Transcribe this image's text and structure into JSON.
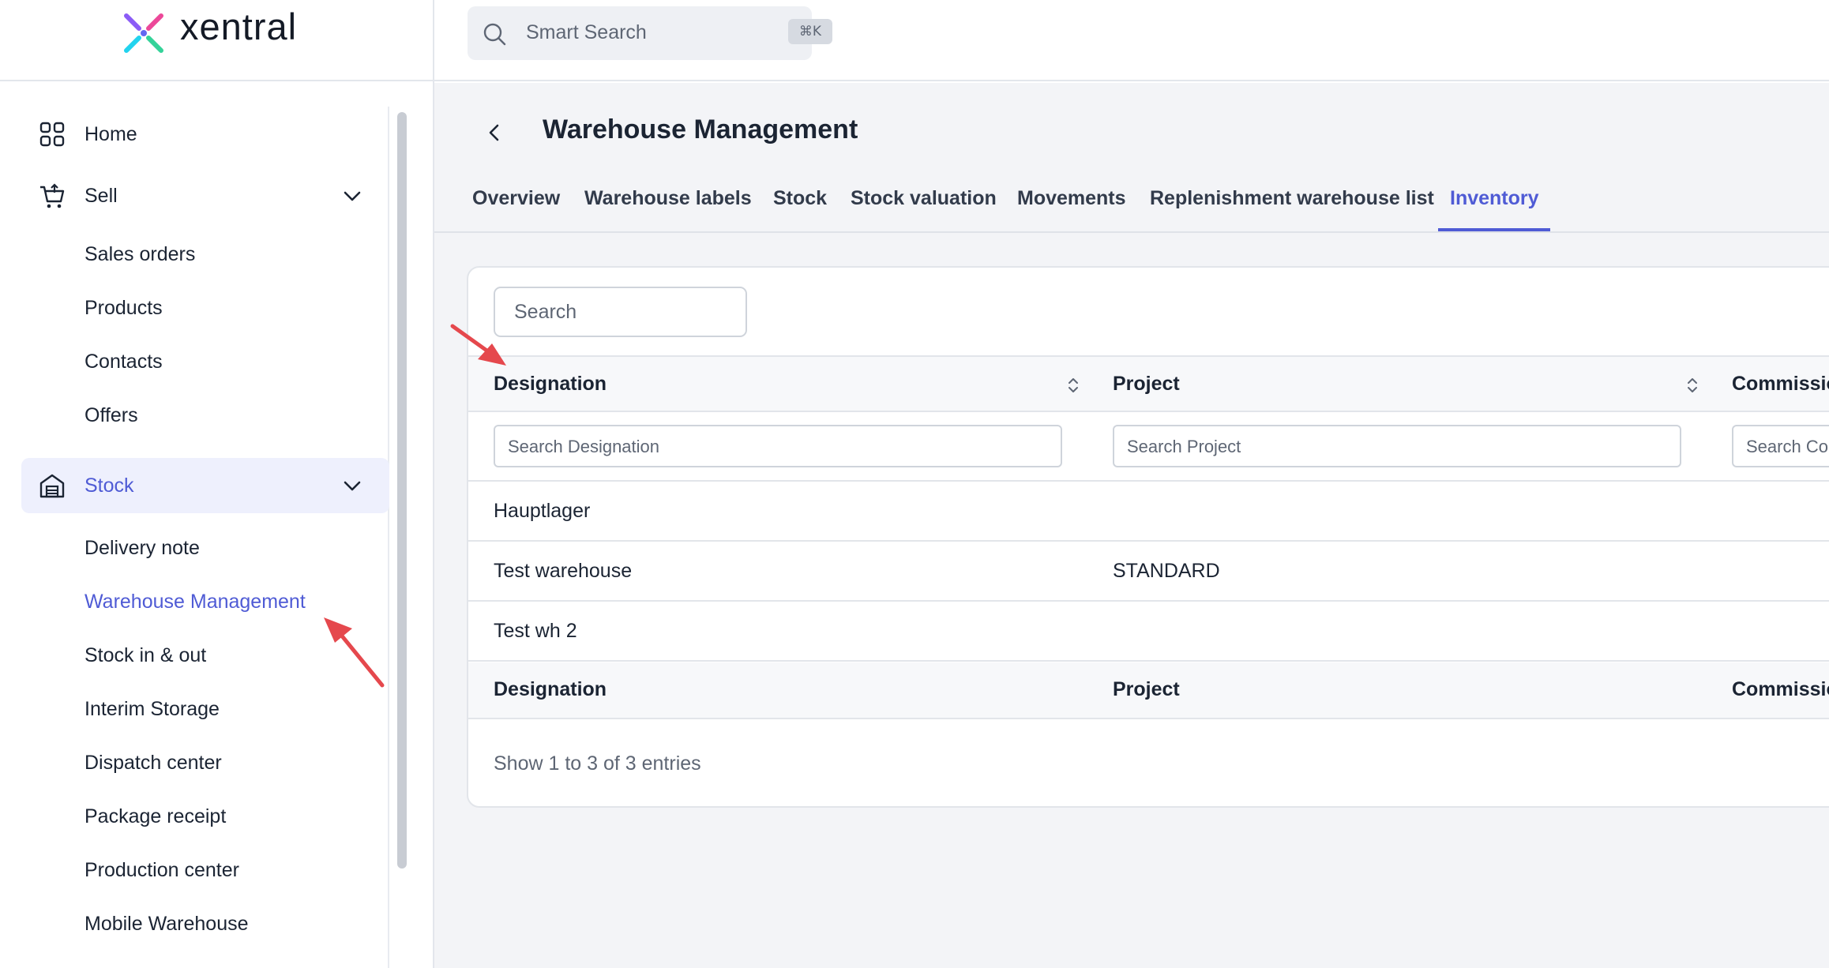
{
  "brand": {
    "name": "xentral"
  },
  "search": {
    "placeholder": "Smart Search",
    "shortcut": "⌘K"
  },
  "sidebar": {
    "items": [
      {
        "label": "Home",
        "icon": "grid-icon"
      },
      {
        "label": "Sell",
        "icon": "cart-icon",
        "expanded": true
      },
      {
        "label": "Stock",
        "icon": "warehouse-icon",
        "expanded": true,
        "active": true
      }
    ],
    "sell_children": [
      "Sales orders",
      "Products",
      "Contacts",
      "Offers"
    ],
    "stock_children": [
      "Delivery note",
      "Warehouse Management",
      "Stock in & out",
      "Interim Storage",
      "Dispatch center",
      "Package receipt",
      "Production center",
      "Mobile Warehouse"
    ],
    "active_child": "Warehouse Management"
  },
  "page": {
    "title": "Warehouse Management"
  },
  "tabs": [
    "Overview",
    "Warehouse labels",
    "Stock",
    "Stock valuation",
    "Movements",
    "Replenishment warehouse list",
    "Inventory"
  ],
  "active_tab": "Inventory",
  "table": {
    "search_placeholder": "Search",
    "columns": [
      "Designation",
      "Project",
      "Commissio"
    ],
    "filters": [
      "Search Designation",
      "Search Project",
      "Search Co"
    ],
    "rows": [
      {
        "designation": "Hauptlager",
        "project": ""
      },
      {
        "designation": "Test warehouse",
        "project": "STANDARD"
      },
      {
        "designation": "Test wh 2",
        "project": ""
      }
    ],
    "footer_columns": [
      "Designation",
      "Project",
      "Commissio"
    ],
    "entries_text": "Show 1 to 3 of 3 entries"
  },
  "colors": {
    "accent": "#4f5bd5",
    "annotation_arrow": "#e5484d"
  }
}
